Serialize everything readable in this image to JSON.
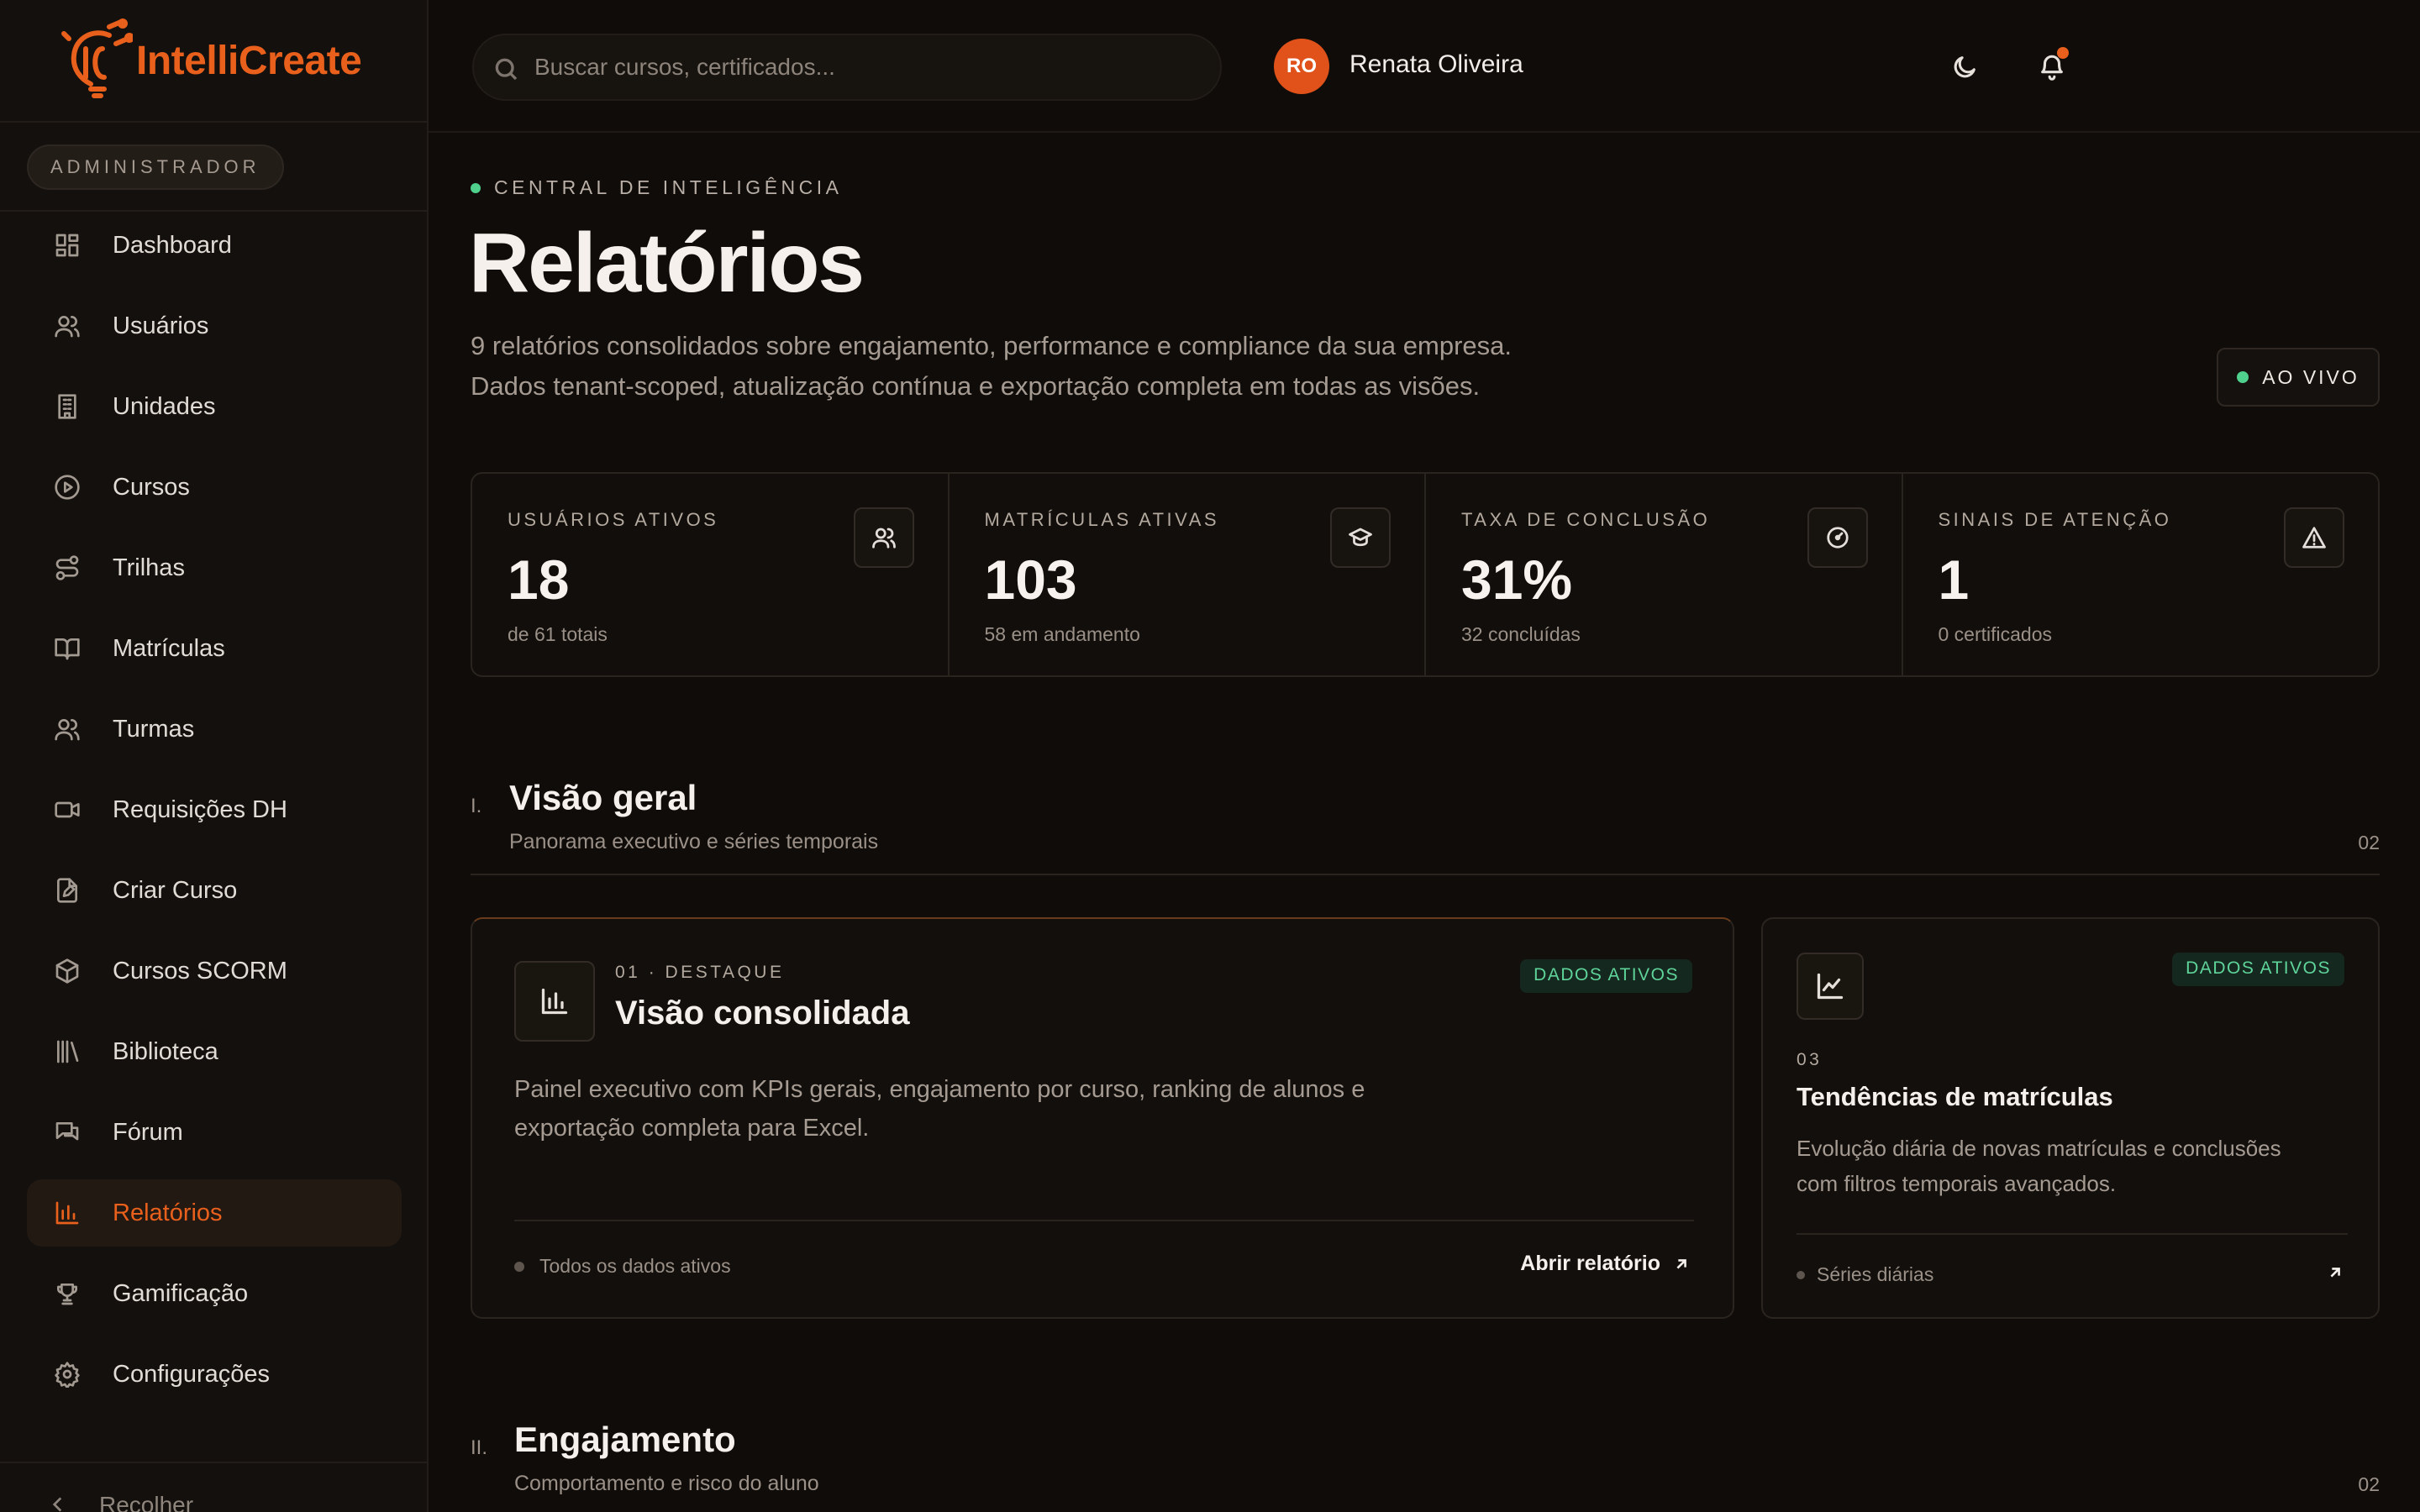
{
  "app": {
    "name": "IntelliCreate",
    "brand_color": "#e8601c"
  },
  "sidebar": {
    "role": "ADMINISTRADOR",
    "items": [
      {
        "label": "Dashboard",
        "icon": "dashboard-icon"
      },
      {
        "label": "Usuários",
        "icon": "users-icon"
      },
      {
        "label": "Unidades",
        "icon": "building-icon"
      },
      {
        "label": "Cursos",
        "icon": "play-circle-icon"
      },
      {
        "label": "Trilhas",
        "icon": "route-icon"
      },
      {
        "label": "Matrículas",
        "icon": "book-open-icon"
      },
      {
        "label": "Turmas",
        "icon": "users-group-icon"
      },
      {
        "label": "Requisições DH",
        "icon": "video-icon"
      },
      {
        "label": "Criar Curso",
        "icon": "file-edit-icon"
      },
      {
        "label": "Cursos SCORM",
        "icon": "package-icon"
      },
      {
        "label": "Biblioteca",
        "icon": "library-icon"
      },
      {
        "label": "Fórum",
        "icon": "chat-icon"
      },
      {
        "label": "Relatórios",
        "icon": "bar-chart-icon",
        "active": true
      },
      {
        "label": "Gamificação",
        "icon": "trophy-icon"
      },
      {
        "label": "Configurações",
        "icon": "gear-icon"
      }
    ],
    "collapse_label": "Recolher"
  },
  "topbar": {
    "search_placeholder": "Buscar cursos, certificados...",
    "user": {
      "initials": "RO",
      "name": "Renata Oliveira"
    }
  },
  "header": {
    "eyebrow": "CENTRAL DE INTELIGÊNCIA",
    "title": "Relatórios",
    "desc_line1": "9 relatórios consolidados sobre engajamento, performance e compliance da sua empresa.",
    "desc_line2": "Dados tenant-scoped, atualização contínua e exportação completa em todas as visões.",
    "live_label": "AO VIVO"
  },
  "kpis": [
    {
      "label": "USUÁRIOS ATIVOS",
      "value": "18",
      "sub": "de 61 totais",
      "icon": "users-icon"
    },
    {
      "label": "MATRÍCULAS ATIVAS",
      "value": "103",
      "sub": "58 em andamento",
      "icon": "graduation-cap-icon"
    },
    {
      "label": "TAXA DE CONCLUSÃO",
      "value": "31%",
      "sub": "32 concluídas",
      "icon": "gauge-icon"
    },
    {
      "label": "SINAIS DE ATENÇÃO",
      "value": "1",
      "sub": "0 certificados",
      "icon": "alert-triangle-icon"
    }
  ],
  "sections": [
    {
      "num": "I.",
      "title": "Visão geral",
      "sub": "Panorama executivo e séries temporais",
      "count": "02"
    },
    {
      "num": "II.",
      "title": "Engajamento",
      "sub": "Comportamento e risco do aluno",
      "count": "02"
    }
  ],
  "cards": {
    "featured": {
      "eyebrow": "01 · DESTAQUE",
      "title": "Visão consolidada",
      "badge": "DADOS ATIVOS",
      "desc_line1": "Painel executivo com KPIs gerais, engajamento por curso, ranking de alunos e",
      "desc_line2": "exportação completa para Excel.",
      "footer": "Todos os dados ativos",
      "link": "Abrir relatório"
    },
    "trends": {
      "num": "03",
      "title": "Tendências de matrículas",
      "badge": "DADOS ATIVOS",
      "desc_line1": "Evolução diária de novas matrículas e conclusões",
      "desc_line2": "com filtros temporais avançados.",
      "footer": "Séries diárias"
    }
  }
}
